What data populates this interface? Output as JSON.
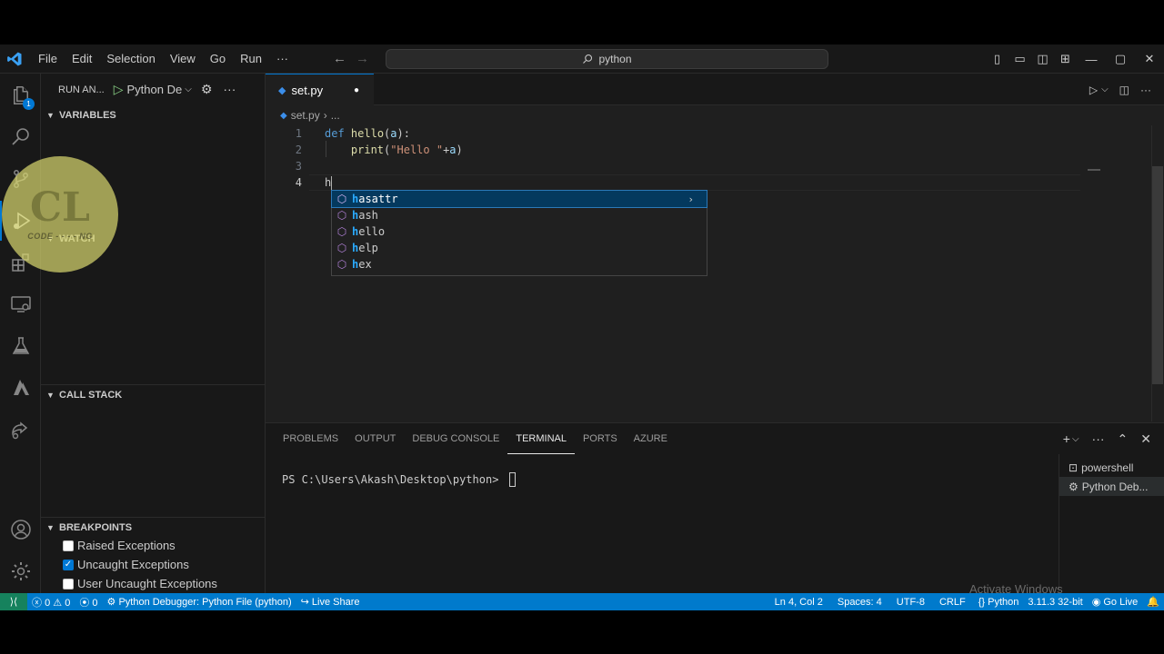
{
  "menu": [
    "File",
    "Edit",
    "Selection",
    "View",
    "Go",
    "Run",
    "···"
  ],
  "search": {
    "text": "python"
  },
  "activity": {
    "explorer_badge": "1"
  },
  "sidebar": {
    "title": "RUN AN...",
    "config": "Python De",
    "sections": {
      "variables": "VARIABLES",
      "watch": "WATCH",
      "callstack": "CALL STACK",
      "breakpoints": "BREAKPOINTS"
    },
    "breakpoints": [
      {
        "label": "Raised Exceptions",
        "checked": false
      },
      {
        "label": "Uncaught Exceptions",
        "checked": true
      },
      {
        "label": "User Uncaught Exceptions",
        "checked": false
      }
    ]
  },
  "watermark": {
    "text": "CODE - - - - NG"
  },
  "editor": {
    "tab": "set.py",
    "breadcrumb_file": "set.py",
    "breadcrumb_rest": "...",
    "line_numbers": [
      "1",
      "2",
      "3",
      "4"
    ],
    "typed": "h"
  },
  "suggestions": [
    {
      "match": "h",
      "rest": "asattr"
    },
    {
      "match": "h",
      "rest": "ash"
    },
    {
      "match": "h",
      "rest": "ello"
    },
    {
      "match": "h",
      "rest": "elp"
    },
    {
      "match": "h",
      "rest": "ex"
    }
  ],
  "panel": {
    "tabs": [
      "PROBLEMS",
      "OUTPUT",
      "DEBUG CONSOLE",
      "TERMINAL",
      "PORTS",
      "AZURE"
    ],
    "active_tab": "TERMINAL",
    "prompt": "PS C:\\Users\\Akash\\Desktop\\python> ",
    "terminals": [
      "powershell",
      "Python Deb..."
    ]
  },
  "activate_windows": "Activate Windows",
  "status": {
    "errors": "0",
    "warnings": "0",
    "ports": "0",
    "debug": "Python Debugger: Python File (python)",
    "liveshare": "Live Share",
    "position": "Ln 4, Col 2",
    "spaces": "Spaces: 4",
    "encoding": "UTF-8",
    "eol": "CRLF",
    "language": "Python",
    "interpreter": "3.11.3 32-bit",
    "golive": "Go Live"
  },
  "colors": {
    "accent": "#0078d4",
    "statusbar": "#007acc",
    "keyword": "#569cd6",
    "function": "#dcdcaa",
    "string": "#ce9178"
  }
}
